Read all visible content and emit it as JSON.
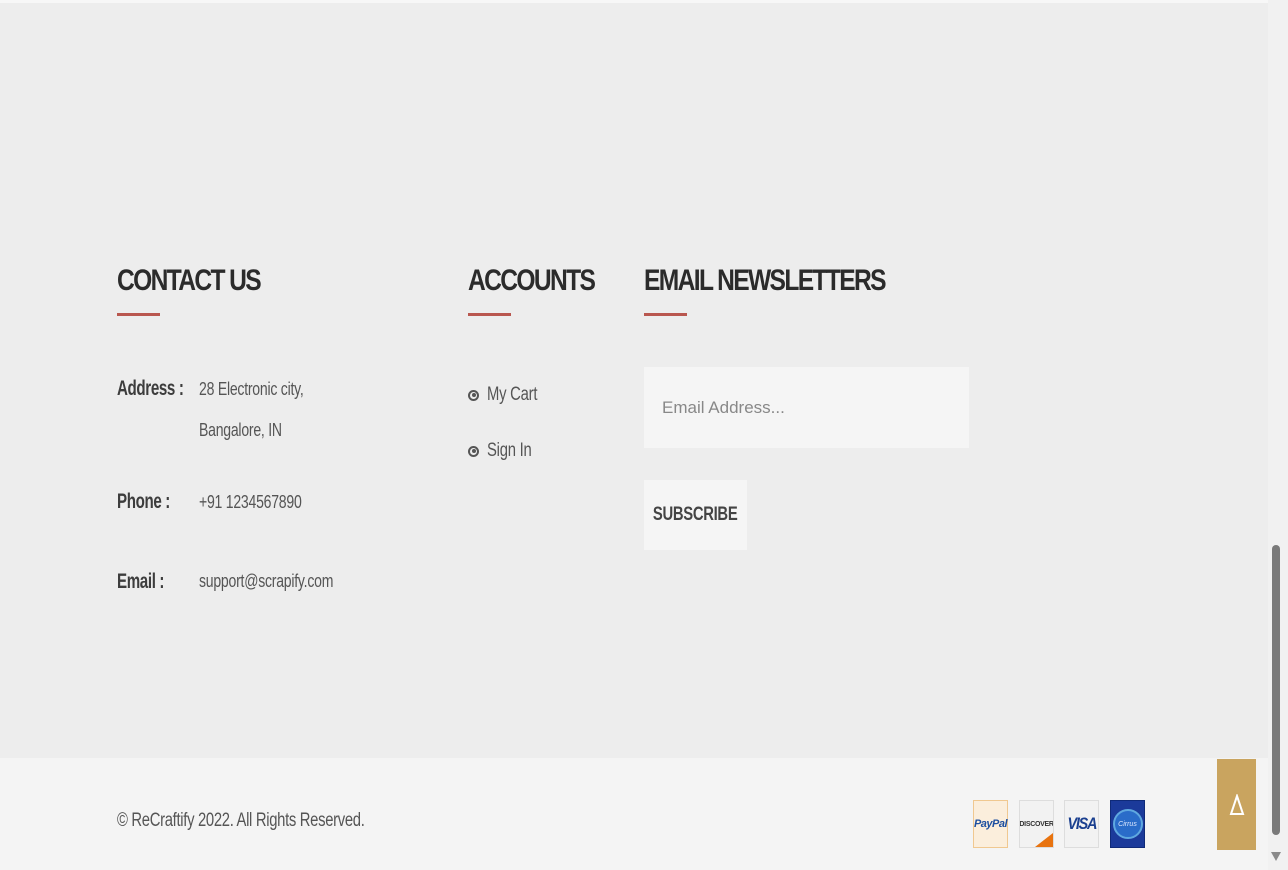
{
  "contact": {
    "title": "CONTACT US",
    "address_label": "Address :",
    "address_line1": "28 Electronic city,",
    "address_line2": "Bangalore, IN",
    "phone_label": "Phone :",
    "phone_value": "+91 1234567890",
    "email_label": "Email :",
    "email_value": "support@scrapify.com"
  },
  "accounts": {
    "title": "ACCOUNTS",
    "items": [
      {
        "label": "My Cart"
      },
      {
        "label": "Sign In"
      }
    ]
  },
  "newsletter": {
    "title": "EMAIL NEWSLETTERS",
    "placeholder": "Email Address...",
    "subscribe_label": "SUBSCRIBE"
  },
  "footer": {
    "copyright": "© ReCraftify 2022. All Rights Reserved.",
    "payments": {
      "paypal": "PayPal",
      "discover": "DISCOVER",
      "visa": "VISA",
      "amex": "Cirrus"
    }
  },
  "colors": {
    "accent_underline": "#b9574f",
    "back_to_top": "#c9a45f",
    "background": "#ededed"
  }
}
